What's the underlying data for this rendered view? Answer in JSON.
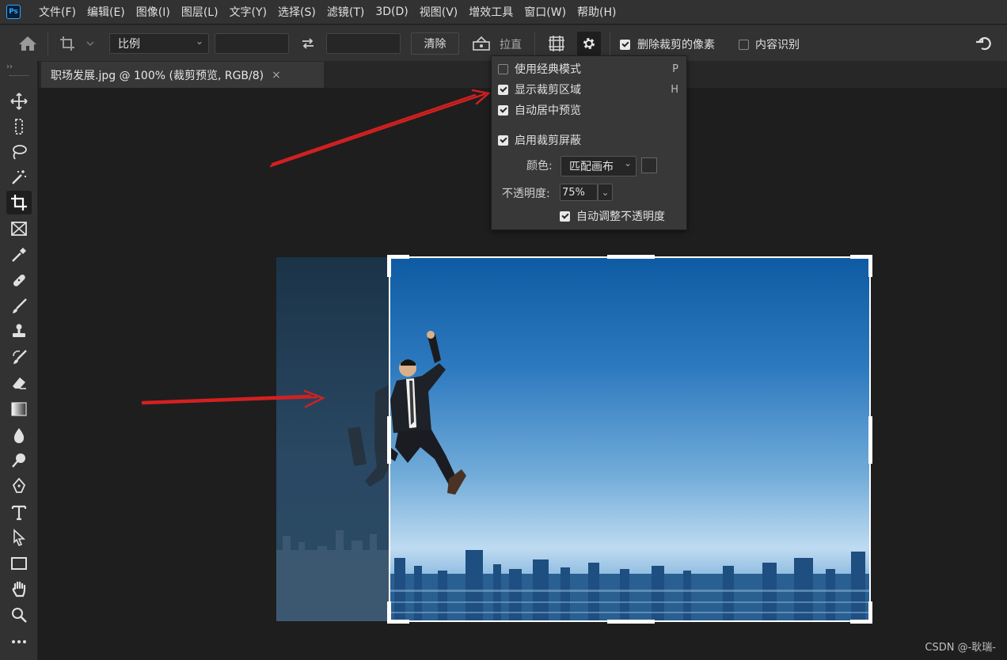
{
  "app": {
    "logo": "Ps",
    "accent": "#31a8ff"
  },
  "menu": [
    "文件(F)",
    "编辑(E)",
    "图像(I)",
    "图层(L)",
    "文字(Y)",
    "选择(S)",
    "滤镜(T)",
    "3D(D)",
    "视图(V)",
    "增效工具",
    "窗口(W)",
    "帮助(H)"
  ],
  "options": {
    "ratio_label": "比例",
    "width_value": "",
    "height_value": "",
    "clear_label": "清除",
    "straighten_label": "拉直",
    "delete_cropped_label": "删除裁剪的像素",
    "delete_cropped_checked": true,
    "content_aware_label": "内容识别",
    "content_aware_checked": false
  },
  "document": {
    "tab_title": "职场发展.jpg @ 100% (裁剪预览, RGB/8)",
    "close_glyph": "×"
  },
  "crop_settings": {
    "classic_mode": {
      "label": "使用经典模式",
      "shortcut": "P",
      "checked": false
    },
    "show_crop_area": {
      "label": "显示裁剪区域",
      "shortcut": "H",
      "checked": true
    },
    "auto_center": {
      "label": "自动居中预览",
      "checked": true
    },
    "enable_shield": {
      "label": "启用裁剪屏蔽",
      "checked": true
    },
    "color_label": "颜色:",
    "color_value": "匹配画布",
    "opacity_label": "不透明度:",
    "opacity_value": "75%",
    "auto_adjust_opacity": {
      "label": "自动调整不透明度",
      "checked": true
    }
  },
  "toolbar_tools": [
    "move-tool",
    "marquee-tool",
    "lasso-tool",
    "magic-wand-tool",
    "crop-tool",
    "frame-tool",
    "eyedropper-tool",
    "healing-brush-tool",
    "brush-tool",
    "clone-stamp-tool",
    "history-brush-tool",
    "eraser-tool",
    "gradient-tool",
    "blur-tool",
    "dodge-tool",
    "pen-tool",
    "type-tool",
    "path-selection-tool",
    "rectangle-tool",
    "hand-tool",
    "zoom-tool",
    "more-tools"
  ],
  "active_tool": "crop-tool",
  "watermark": "CSDN @-耿瑞-",
  "colors": {
    "annotation_arrow": "#d42020",
    "panel_bg": "#383838"
  }
}
